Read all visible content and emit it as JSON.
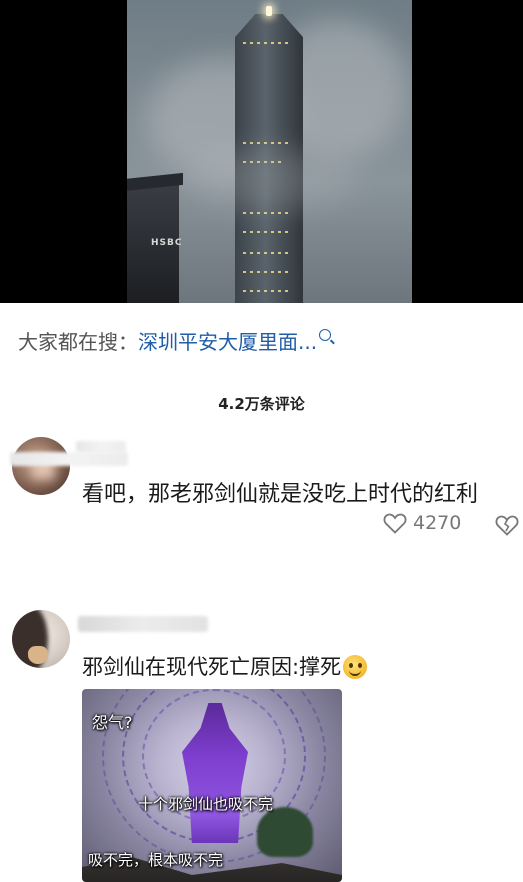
{
  "video": {
    "building_sign": "HSBC"
  },
  "search": {
    "prefix": "大家都在搜：",
    "query": "深圳平安大厦里面...",
    "icon": "search-icon"
  },
  "comments_header": {
    "count_label": "4.2万条评论"
  },
  "comments": [
    {
      "text": "看吧，那老邪剑仙就是没吃上时代的红利",
      "likes": "4270",
      "like_icon": "heart-outline-icon",
      "dislike_icon": "broken-heart-icon"
    },
    {
      "text": "邪剑仙在现代死亡原因:撑死",
      "emoji": "smirk-emoji-icon",
      "image": {
        "caption_top": "怨气?",
        "caption_middle": "十个邪剑仙也吸不完",
        "caption_bottom": "吸不完，根本吸不完"
      }
    }
  ],
  "colors": {
    "link": "#1f5da8",
    "text": "#1a1a1a",
    "muted": "#777777"
  }
}
